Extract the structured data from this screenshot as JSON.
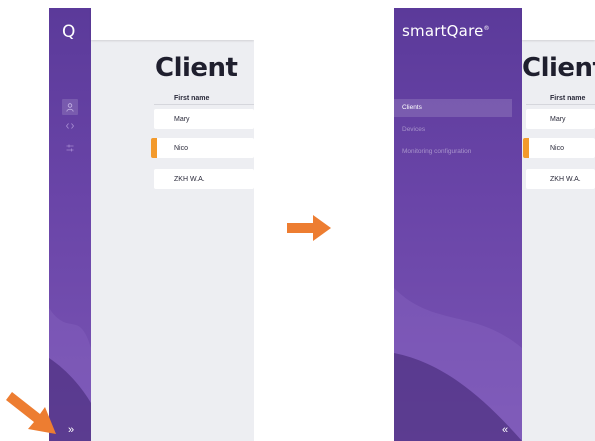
{
  "before": {
    "logo": "Q",
    "page_title": "Client",
    "column_header": "First name",
    "rows": [
      "Mary",
      "Nico",
      "ZKH W.A."
    ],
    "nav_icons": [
      "user-icon",
      "devices-icon",
      "sliders-icon"
    ],
    "expand_button": "»"
  },
  "after": {
    "logo": "smartQare",
    "logo_mark": "®",
    "page_title": "Clients",
    "column_header": "First name",
    "rows": [
      "Mary",
      "Nico",
      "ZKH W.A."
    ],
    "menu": [
      "Clients",
      "Devices",
      "Monitoring configuration"
    ],
    "collapse_button": "«"
  },
  "colors": {
    "sidebar_purple": "#5b3a9a",
    "accent_orange": "#f39a2c",
    "annotation_orange": "#ed7d31",
    "content_bg": "#edeef2"
  }
}
